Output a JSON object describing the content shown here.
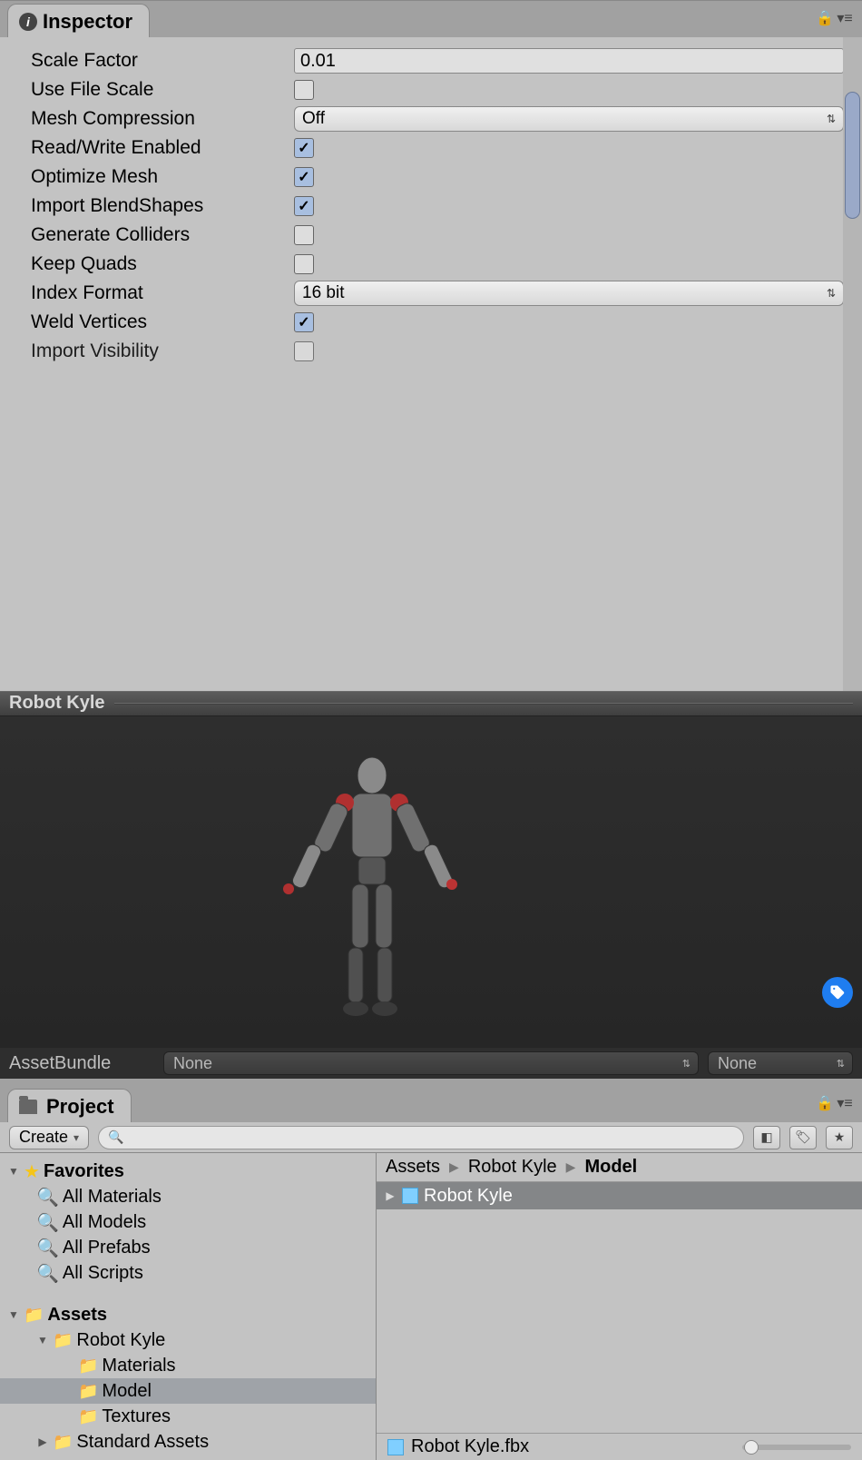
{
  "inspector": {
    "tab_label": "Inspector",
    "properties": {
      "scale_factor": {
        "label": "Scale Factor",
        "value": "0.01"
      },
      "use_file_scale": {
        "label": "Use File Scale",
        "checked": false
      },
      "mesh_compression": {
        "label": "Mesh Compression",
        "value": "Off"
      },
      "read_write": {
        "label": "Read/Write Enabled",
        "checked": true
      },
      "optimize_mesh": {
        "label": "Optimize Mesh",
        "checked": true
      },
      "import_blendshapes": {
        "label": "Import BlendShapes",
        "checked": true
      },
      "generate_colliders": {
        "label": "Generate Colliders",
        "checked": false
      },
      "keep_quads": {
        "label": "Keep Quads",
        "checked": false
      },
      "index_format": {
        "label": "Index Format",
        "value": "16 bit"
      },
      "weld_vertices": {
        "label": "Weld Vertices",
        "checked": true
      },
      "import_visibility": {
        "label": "Import Visibility",
        "checked": false
      }
    }
  },
  "preview": {
    "title": "Robot Kyle",
    "footer_label": "AssetBundle",
    "bundle_value": "None",
    "variant_value": "None"
  },
  "project": {
    "tab_label": "Project",
    "create_label": "Create",
    "search_placeholder": "",
    "breadcrumb": [
      "Assets",
      "Robot Kyle",
      "Model"
    ],
    "tree": {
      "favorites": {
        "label": "Favorites",
        "items": [
          "All Materials",
          "All Models",
          "All Prefabs",
          "All Scripts"
        ]
      },
      "assets": {
        "label": "Assets",
        "children": [
          {
            "label": "Robot Kyle",
            "expanded": true,
            "children": [
              {
                "label": "Materials"
              },
              {
                "label": "Model",
                "selected": true
              },
              {
                "label": "Textures"
              }
            ]
          },
          {
            "label": "Standard Assets",
            "expanded": false
          }
        ]
      }
    },
    "content_items": [
      {
        "label": "Robot Kyle",
        "type": "prefab"
      }
    ],
    "footer_file": "Robot Kyle.fbx"
  }
}
